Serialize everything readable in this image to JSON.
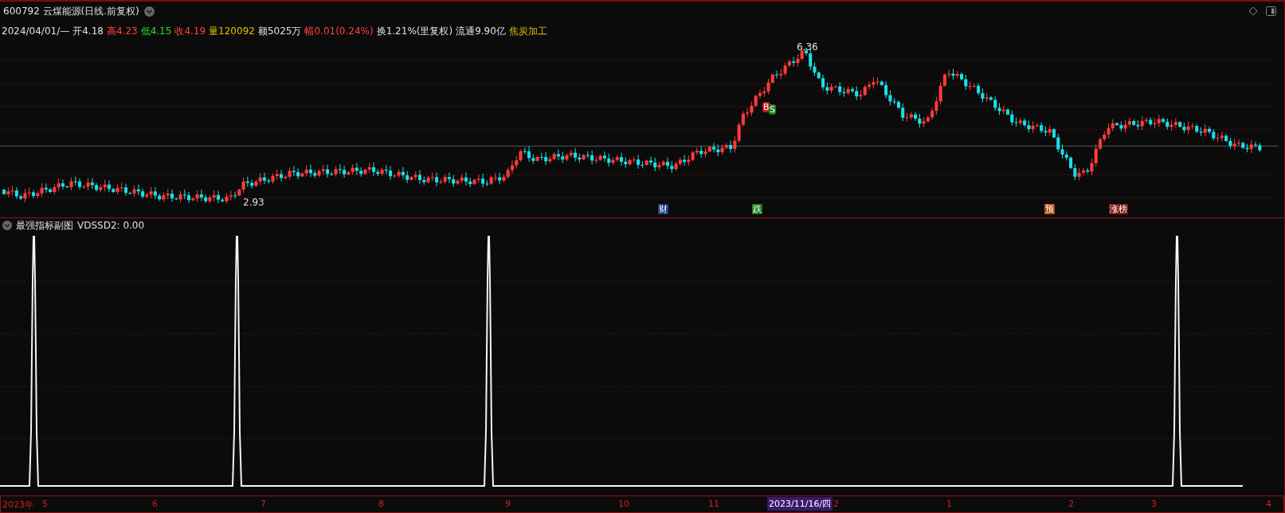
{
  "header": {
    "title": "600792 云煤能源(日线.前复权)"
  },
  "quote": {
    "date": "2024/04/01/—",
    "items": [
      {
        "label": "开",
        "value": "4.18",
        "color": "#e0e0e0"
      },
      {
        "label": "高",
        "value": "4.23",
        "color": "#ff4040"
      },
      {
        "label": "低",
        "value": "4.15",
        "color": "#20e020"
      },
      {
        "label": "收",
        "value": "4.19",
        "color": "#ff4040"
      },
      {
        "label": "量",
        "value": "120092",
        "color": "#e0c000"
      },
      {
        "label": "额",
        "value": "5025万",
        "color": "#e0e0e0"
      },
      {
        "label": "幅",
        "value": "0.01(0.24%)",
        "color": "#ff4040"
      },
      {
        "label": "换",
        "value": "1.21%(里复权)",
        "color": "#e0e0e0"
      },
      {
        "label": "流通",
        "value": "9.90亿",
        "color": "#e0e0e0"
      }
    ],
    "industry": "焦炭加工"
  },
  "price_labels": {
    "high": "6.36",
    "low": "2.93"
  },
  "signals": [
    {
      "label": "B",
      "color": "#c01818"
    },
    {
      "label": "S",
      "color": "#18801c"
    }
  ],
  "events": [
    {
      "label": "财",
      "color": "#1c3c80"
    },
    {
      "label": "跌",
      "color": "#1a7a1a"
    },
    {
      "label": "预",
      "color": "#b04a10"
    },
    {
      "label": "涨榜",
      "color": "#801818"
    }
  ],
  "indicator": {
    "name": "最强指标副图",
    "reading": "VDSSD2: 0.00"
  },
  "axis": {
    "year": "2023年",
    "ticks": [
      "5",
      "6",
      "7",
      "8",
      "9",
      "10",
      "11",
      "2",
      "1",
      "2",
      "3",
      "4"
    ],
    "cursor_date": "2023/11/16/四"
  }
}
